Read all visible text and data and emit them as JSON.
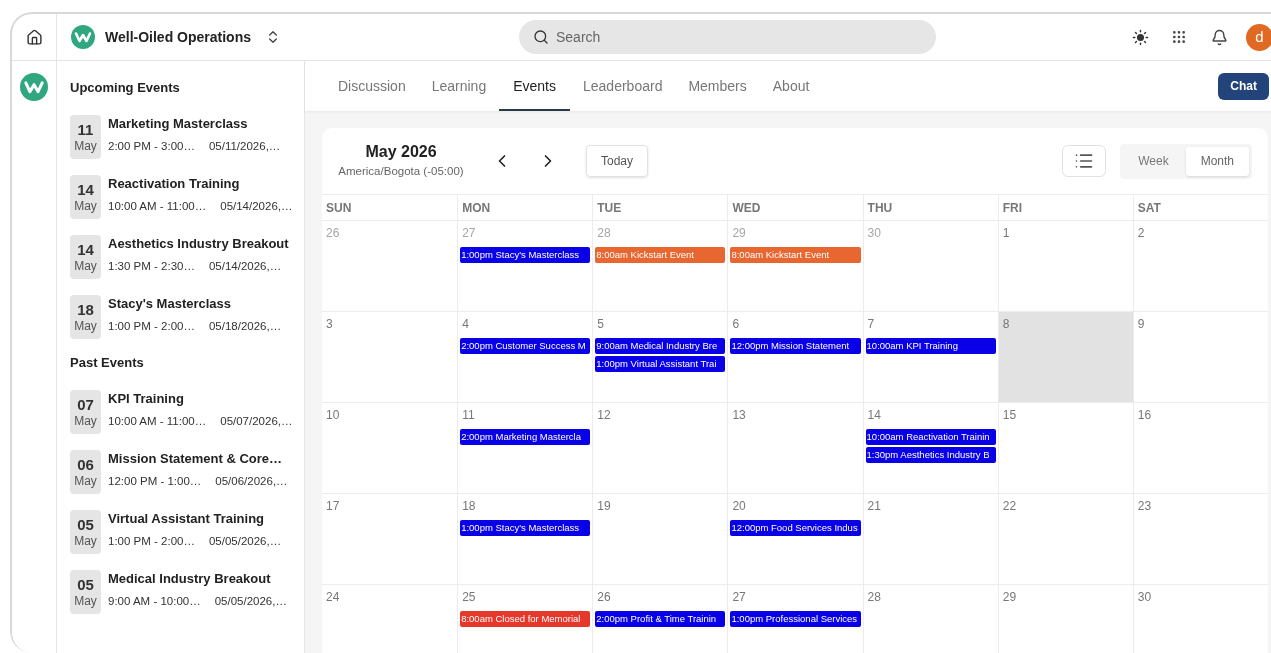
{
  "community": {
    "name": "Well-Oiled Operations"
  },
  "search": {
    "placeholder": "Search"
  },
  "user": {
    "initial": "d"
  },
  "sidebar": {
    "sections": [
      {
        "title": "Upcoming Events",
        "events": [
          {
            "day": "11",
            "month": "May",
            "title": "Marketing Masterclass",
            "time": "2:00 PM - 3:00…",
            "date": "05/11/2026,…"
          },
          {
            "day": "14",
            "month": "May",
            "title": "Reactivation Training",
            "time": "10:00 AM - 11:00…",
            "date": "05/14/2026,…"
          },
          {
            "day": "14",
            "month": "May",
            "title": "Aesthetics Industry Breakout",
            "time": "1:30 PM - 2:30…",
            "date": "05/14/2026,…"
          },
          {
            "day": "18",
            "month": "May",
            "title": "Stacy's Masterclass",
            "time": "1:00 PM - 2:00…",
            "date": "05/18/2026,…"
          }
        ]
      },
      {
        "title": "Past Events",
        "events": [
          {
            "day": "07",
            "month": "May",
            "title": "KPI Training",
            "time": "10:00 AM - 11:00…",
            "date": "05/07/2026,…"
          },
          {
            "day": "06",
            "month": "May",
            "title": "Mission Statement & Core…",
            "time": "12:00 PM - 1:00…",
            "date": "05/06/2026,…"
          },
          {
            "day": "05",
            "month": "May",
            "title": "Virtual Assistant Training",
            "time": "1:00 PM - 2:00…",
            "date": "05/05/2026,…"
          },
          {
            "day": "05",
            "month": "May",
            "title": "Medical Industry Breakout",
            "time": "9:00 AM - 10:00…",
            "date": "05/05/2026,…"
          }
        ]
      }
    ]
  },
  "tabs": [
    {
      "label": "Discussion",
      "selected": false
    },
    {
      "label": "Learning",
      "selected": false
    },
    {
      "label": "Events",
      "selected": true
    },
    {
      "label": "Leaderboard",
      "selected": false
    },
    {
      "label": "Members",
      "selected": false
    },
    {
      "label": "About",
      "selected": false
    }
  ],
  "chat_button": "Chat",
  "calendar": {
    "title": "May 2026",
    "timezone": "America/Bogota (-05:00)",
    "today_button": "Today",
    "views": [
      {
        "label": "Week",
        "selected": false
      },
      {
        "label": "Month",
        "selected": true
      }
    ],
    "weekdays": [
      "SUN",
      "MON",
      "TUE",
      "WED",
      "THU",
      "FRI",
      "SAT"
    ],
    "weeks": [
      [
        {
          "day": "26",
          "muted": true,
          "selected": false
        },
        {
          "day": "27",
          "muted": true,
          "selected": false,
          "events": [
            {
              "label": "1:00pm Stacy's Masterclass",
              "color": "#0a00e8"
            }
          ]
        },
        {
          "day": "28",
          "muted": true,
          "selected": false,
          "events": [
            {
              "label": "8:00am Kickstart Event",
              "color": "#e8662f"
            }
          ]
        },
        {
          "day": "29",
          "muted": true,
          "selected": false,
          "events": [
            {
              "label": "8:00am Kickstart Event",
              "color": "#e8662f"
            }
          ]
        },
        {
          "day": "30",
          "muted": true,
          "selected": false
        },
        {
          "day": "1",
          "muted": false,
          "selected": false
        },
        {
          "day": "2",
          "muted": false,
          "selected": false
        }
      ],
      [
        {
          "day": "3",
          "muted": false,
          "selected": false
        },
        {
          "day": "4",
          "muted": false,
          "selected": false,
          "events": [
            {
              "label": "2:00pm Customer Success M",
              "color": "#0a00e8"
            }
          ]
        },
        {
          "day": "5",
          "muted": false,
          "selected": false,
          "events": [
            {
              "label": "9:00am Medical Industry Bre",
              "color": "#0a00e8"
            },
            {
              "label": "1:00pm Virtual Assistant Trai",
              "color": "#0a00e8"
            }
          ]
        },
        {
          "day": "6",
          "muted": false,
          "selected": false,
          "events": [
            {
              "label": "12:00pm Mission Statement",
              "color": "#0a00e8"
            }
          ]
        },
        {
          "day": "7",
          "muted": false,
          "selected": false,
          "events": [
            {
              "label": "10:00am KPI Training",
              "color": "#0a00e8"
            }
          ]
        },
        {
          "day": "8",
          "muted": false,
          "selected": true
        },
        {
          "day": "9",
          "muted": false,
          "selected": false
        }
      ],
      [
        {
          "day": "10",
          "muted": false,
          "selected": false
        },
        {
          "day": "11",
          "muted": false,
          "selected": false,
          "events": [
            {
              "label": "2:00pm Marketing Mastercla",
              "color": "#0a00e8"
            }
          ]
        },
        {
          "day": "12",
          "muted": false,
          "selected": false
        },
        {
          "day": "13",
          "muted": false,
          "selected": false
        },
        {
          "day": "14",
          "muted": false,
          "selected": false,
          "events": [
            {
              "label": "10:00am Reactivation Trainin",
              "color": "#0a00e8"
            },
            {
              "label": "1:30pm Aesthetics Industry B",
              "color": "#0a00e8"
            }
          ]
        },
        {
          "day": "15",
          "muted": false,
          "selected": false
        },
        {
          "day": "16",
          "muted": false,
          "selected": false
        }
      ],
      [
        {
          "day": "17",
          "muted": false,
          "selected": false
        },
        {
          "day": "18",
          "muted": false,
          "selected": false,
          "events": [
            {
              "label": "1:00pm Stacy's Masterclass",
              "color": "#0a00e8"
            }
          ]
        },
        {
          "day": "19",
          "muted": false,
          "selected": false
        },
        {
          "day": "20",
          "muted": false,
          "selected": false,
          "events": [
            {
              "label": "12:00pm Food Services Indus",
              "color": "#0a00e8"
            }
          ]
        },
        {
          "day": "21",
          "muted": false,
          "selected": false
        },
        {
          "day": "22",
          "muted": false,
          "selected": false
        },
        {
          "day": "23",
          "muted": false,
          "selected": false
        }
      ],
      [
        {
          "day": "24",
          "muted": false,
          "selected": false
        },
        {
          "day": "25",
          "muted": false,
          "selected": false,
          "events": [
            {
              "label": "8:00am Closed for Memorial",
              "color": "#e5372a"
            }
          ]
        },
        {
          "day": "26",
          "muted": false,
          "selected": false,
          "events": [
            {
              "label": "2:00pm Profit & Time Trainin",
              "color": "#0a00e8"
            }
          ]
        },
        {
          "day": "27",
          "muted": false,
          "selected": false,
          "events": [
            {
              "label": "1:00pm Professional Services",
              "color": "#0a00e8"
            }
          ]
        },
        {
          "day": "28",
          "muted": false,
          "selected": false
        },
        {
          "day": "29",
          "muted": false,
          "selected": false
        },
        {
          "day": "30",
          "muted": false,
          "selected": false
        }
      ]
    ]
  }
}
